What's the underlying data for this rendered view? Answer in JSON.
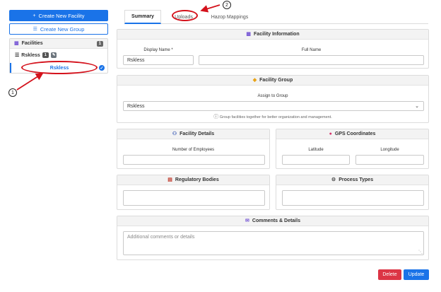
{
  "sidebar": {
    "create_facility": "Create New Facility",
    "create_group": "Create New Group",
    "facilities_title": "Facilities",
    "facilities_count": "1",
    "group_name": "Rskless",
    "group_count": "1",
    "facility_item": "Rskless"
  },
  "tabs": {
    "summary": "Summary",
    "uploads": "Uploads",
    "hazop": "Hazop Mappings"
  },
  "facility_info": {
    "title": "Facility Information",
    "display_name_label": "Display Name *",
    "display_name_value": "Rskless",
    "full_name_label": "Full Name",
    "full_name_value": ""
  },
  "facility_group": {
    "title": "Facility Group",
    "assign_label": "Assign to Group",
    "selected": "Rskless",
    "hint": "Group facilities together for better organization and management."
  },
  "facility_details": {
    "title": "Facility Details",
    "employees_label": "Number of Employees",
    "employees_value": ""
  },
  "gps": {
    "title": "GPS Coordinates",
    "latitude_label": "Latitude",
    "longitude_label": "Longitude"
  },
  "regulatory": {
    "title": "Regulatory Bodies"
  },
  "process_types": {
    "title": "Process Types"
  },
  "comments": {
    "title": "Comments & Details",
    "placeholder": "Additional comments or details"
  },
  "actions": {
    "delete": "Delete",
    "update": "Update"
  },
  "annotations": {
    "one": "1",
    "two": "2"
  },
  "colors": {
    "primary": "#1a73e8",
    "danger": "#dc3545",
    "annotation": "#d4121c"
  }
}
